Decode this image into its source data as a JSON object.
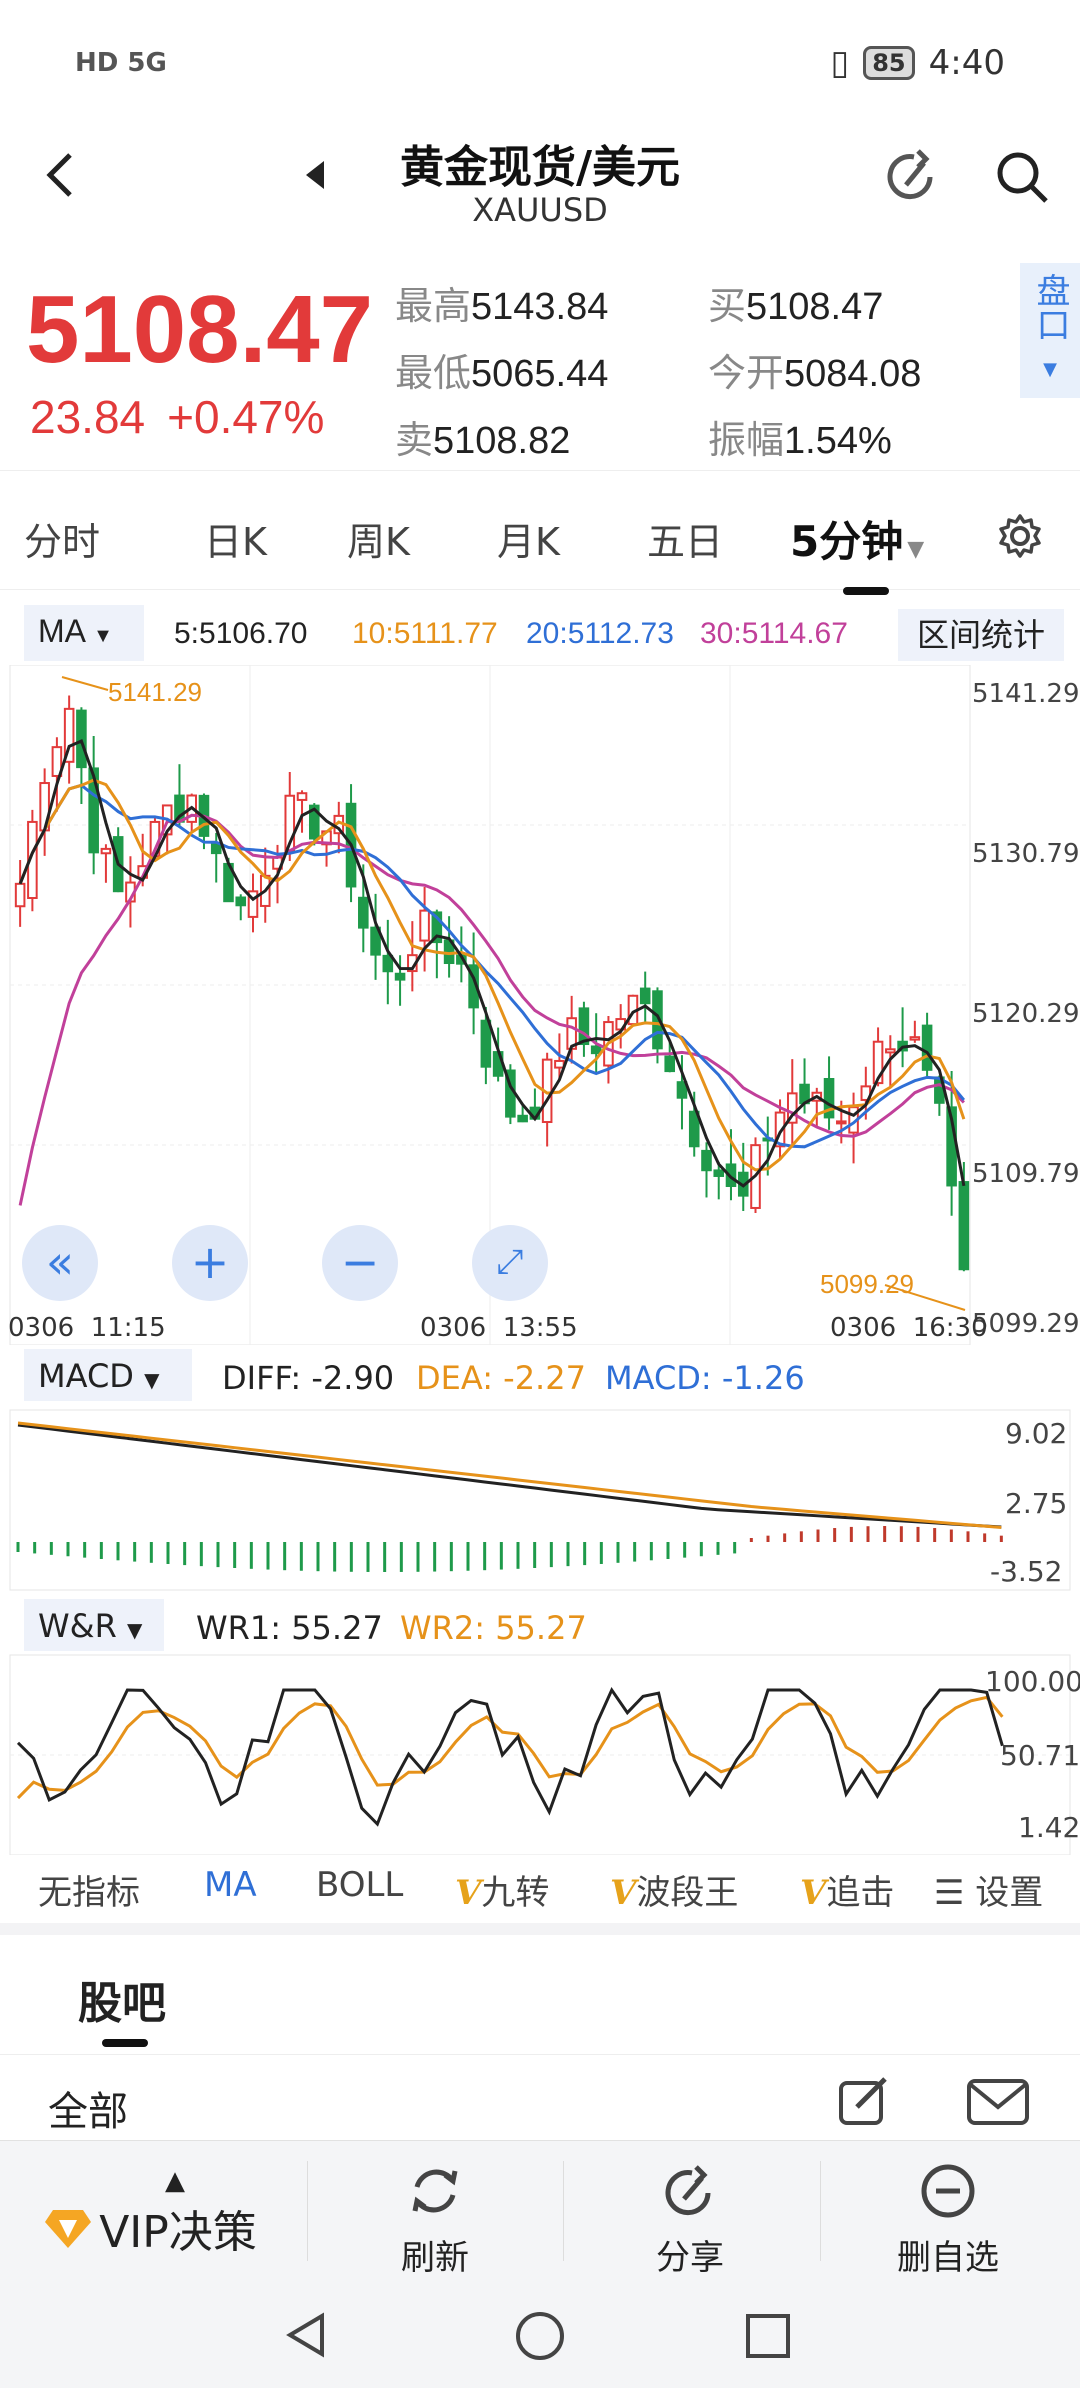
{
  "status": {
    "left": "HD 5G",
    "battery": "85",
    "time": "4:40"
  },
  "header": {
    "title": "黄金现货/美元",
    "symbol": "XAUUSD"
  },
  "quote": {
    "price": "5108.47",
    "change": "23.84",
    "change_pct": "+0.47%",
    "high_label": "最高",
    "high": "5143.84",
    "low_label": "最低",
    "low": "5065.44",
    "sell_label": "卖",
    "sell": "5108.82",
    "buy_label": "买",
    "buy": "5108.47",
    "open_label": "今开",
    "open": "5084.08",
    "amp_label": "振幅",
    "amp": "1.54%",
    "pankou": "盘口"
  },
  "tabs": [
    "分时",
    "日K",
    "周K",
    "月K",
    "五日",
    "5分钟"
  ],
  "ma": {
    "selector": "MA",
    "ma5": "5:5106.70",
    "ma10": "10:5111.77",
    "ma20": "20:5112.73",
    "ma30": "30:5114.67",
    "range_btn": "区间统计"
  },
  "main_chart": {
    "y_labels": [
      "5141.29",
      "5130.79",
      "5120.29",
      "5109.79",
      "5099.29"
    ],
    "x_labels": [
      "0306  11:15",
      "0306  13:55",
      "0306  16:30"
    ],
    "high_mark": "5141.29",
    "low_mark": "5099.29"
  },
  "macd": {
    "selector": "MACD",
    "diff": "DIFF: -2.90",
    "dea": "DEA: -2.27",
    "macd": "MACD: -1.26",
    "y_labels": [
      "9.02",
      "2.75",
      "-3.52"
    ]
  },
  "wr": {
    "selector": "W&R",
    "wr1": "WR1: 55.27",
    "wr2": "WR2: 55.27",
    "y_labels": [
      "100.00",
      "50.71",
      "1.42"
    ]
  },
  "indicator_tabs": {
    "none": "无指标",
    "ma": "MA",
    "boll": "BOLL",
    "jiuzhuan": "九转",
    "boduan": "波段王",
    "zhuiji": "追击",
    "settings": "设置"
  },
  "guba": {
    "title": "股吧",
    "all": "全部"
  },
  "bottom": {
    "vip": "VIP决策",
    "refresh": "刷新",
    "share": "分享",
    "remove": "删自选"
  },
  "colors": {
    "up": "#e23a3a",
    "down": "#1e9a4a",
    "accent": "#3b7de0",
    "ma10": "#e6921a",
    "ma20": "#2f6fd6",
    "ma30": "#c1409a"
  }
}
